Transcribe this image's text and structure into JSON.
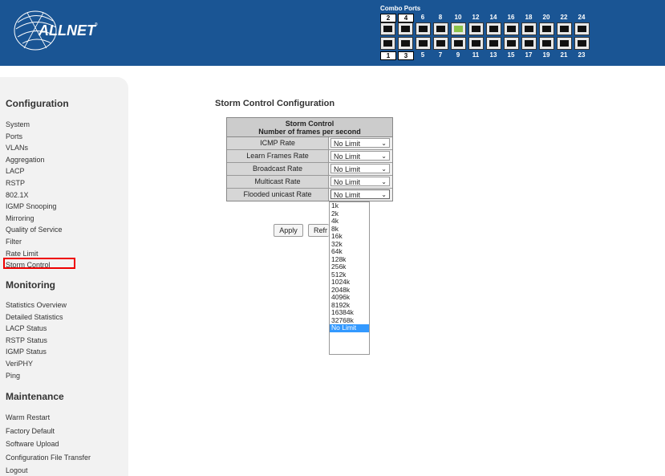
{
  "header": {
    "brand": "ALLNET",
    "combo_label": "Combo Ports",
    "top_ports": [
      "2",
      "4",
      "6",
      "8",
      "10",
      "12",
      "14",
      "16",
      "18",
      "20",
      "22",
      "24"
    ],
    "bottom_ports": [
      "1",
      "3",
      "5",
      "7",
      "9",
      "11",
      "13",
      "15",
      "17",
      "19",
      "21",
      "23"
    ]
  },
  "sidebar": {
    "configuration": {
      "title": "Configuration",
      "items": [
        "System",
        "Ports",
        "VLANs",
        "Aggregation",
        "LACP",
        "RSTP",
        "802.1X",
        "IGMP Snooping",
        "Mirroring",
        "Quality of Service",
        "Filter",
        "Rate Limit",
        "Storm Control"
      ]
    },
    "monitoring": {
      "title": "Monitoring",
      "items": [
        "Statistics Overview",
        "Detailed Statistics",
        "LACP Status",
        "RSTP Status",
        "IGMP Status",
        "VeriPHY",
        "Ping"
      ]
    },
    "maintenance": {
      "title": "Maintenance",
      "items": [
        "Warm Restart",
        "Factory Default",
        "Software Upload",
        "Configuration File Transfer",
        "Logout"
      ]
    }
  },
  "main": {
    "title": "Storm Control Configuration",
    "table": {
      "header_line1": "Storm Control",
      "header_line2": "Number of frames per second",
      "rows": [
        {
          "label": "ICMP Rate",
          "value": "No Limit"
        },
        {
          "label": "Learn Frames Rate",
          "value": "No Limit"
        },
        {
          "label": "Broadcast Rate",
          "value": "No Limit"
        },
        {
          "label": "Multicast Rate",
          "value": "No Limit"
        },
        {
          "label": "Flooded unicast Rate",
          "value": "No Limit"
        }
      ]
    },
    "apply_label": "Apply",
    "refresh_label": "Refr",
    "dropdown_options": [
      "1k",
      "2k",
      "4k",
      "8k",
      "16k",
      "32k",
      "64k",
      "128k",
      "256k",
      "512k",
      "1024k",
      "2048k",
      "4096k",
      "8192k",
      "16384k",
      "32768k",
      "No Limit"
    ],
    "dropdown_selected": "No Limit"
  }
}
